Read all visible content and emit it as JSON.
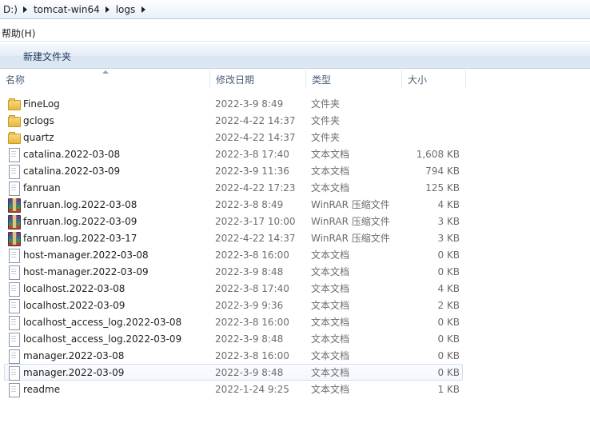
{
  "address": {
    "crumbs": [
      "D:)",
      "tomcat-win64",
      "logs"
    ]
  },
  "menu": {
    "help": "帮助(H)"
  },
  "toolbar": {
    "new_folder": "新建文件夹"
  },
  "columns": {
    "name": "名称",
    "date": "修改日期",
    "type": "类型",
    "size": "大小"
  },
  "files": [
    {
      "icon": "folder-icon",
      "name": "FineLog",
      "date": "2022-3-9 8:49",
      "type": "文件夹",
      "size": ""
    },
    {
      "icon": "folder-icon",
      "name": "gclogs",
      "date": "2022-4-22 14:37",
      "type": "文件夹",
      "size": ""
    },
    {
      "icon": "folder-icon",
      "name": "quartz",
      "date": "2022-4-22 14:37",
      "type": "文件夹",
      "size": ""
    },
    {
      "icon": "text-document-icon",
      "name": "catalina.2022-03-08",
      "date": "2022-3-8 17:40",
      "type": "文本文档",
      "size": "1,608 KB"
    },
    {
      "icon": "text-document-icon",
      "name": "catalina.2022-03-09",
      "date": "2022-3-9 11:36",
      "type": "文本文档",
      "size": "794 KB"
    },
    {
      "icon": "text-document-icon",
      "name": "fanruan",
      "date": "2022-4-22 17:23",
      "type": "文本文档",
      "size": "125 KB"
    },
    {
      "icon": "winrar-archive-icon",
      "name": "fanruan.log.2022-03-08",
      "date": "2022-3-8 8:49",
      "type": "WinRAR 压缩文件",
      "size": "4 KB"
    },
    {
      "icon": "winrar-archive-icon",
      "name": "fanruan.log.2022-03-09",
      "date": "2022-3-17 10:00",
      "type": "WinRAR 压缩文件",
      "size": "3 KB"
    },
    {
      "icon": "winrar-archive-icon",
      "name": "fanruan.log.2022-03-17",
      "date": "2022-4-22 14:37",
      "type": "WinRAR 压缩文件",
      "size": "3 KB"
    },
    {
      "icon": "text-document-icon",
      "name": "host-manager.2022-03-08",
      "date": "2022-3-8 16:00",
      "type": "文本文档",
      "size": "0 KB"
    },
    {
      "icon": "text-document-icon",
      "name": "host-manager.2022-03-09",
      "date": "2022-3-9 8:48",
      "type": "文本文档",
      "size": "0 KB"
    },
    {
      "icon": "text-document-icon",
      "name": "localhost.2022-03-08",
      "date": "2022-3-8 17:40",
      "type": "文本文档",
      "size": "4 KB"
    },
    {
      "icon": "text-document-icon",
      "name": "localhost.2022-03-09",
      "date": "2022-3-9 9:36",
      "type": "文本文档",
      "size": "2 KB"
    },
    {
      "icon": "text-document-icon",
      "name": "localhost_access_log.2022-03-08",
      "date": "2022-3-8 16:00",
      "type": "文本文档",
      "size": "0 KB"
    },
    {
      "icon": "text-document-icon",
      "name": "localhost_access_log.2022-03-09",
      "date": "2022-3-9 8:48",
      "type": "文本文档",
      "size": "0 KB"
    },
    {
      "icon": "text-document-icon",
      "name": "manager.2022-03-08",
      "date": "2022-3-8 16:00",
      "type": "文本文档",
      "size": "0 KB"
    },
    {
      "icon": "text-document-icon",
      "name": "manager.2022-03-09",
      "date": "2022-3-9 8:48",
      "type": "文本文档",
      "size": "0 KB",
      "selected": true
    },
    {
      "icon": "text-document-icon",
      "name": "readme",
      "date": "2022-1-24 9:25",
      "type": "文本文档",
      "size": "1 KB"
    }
  ]
}
